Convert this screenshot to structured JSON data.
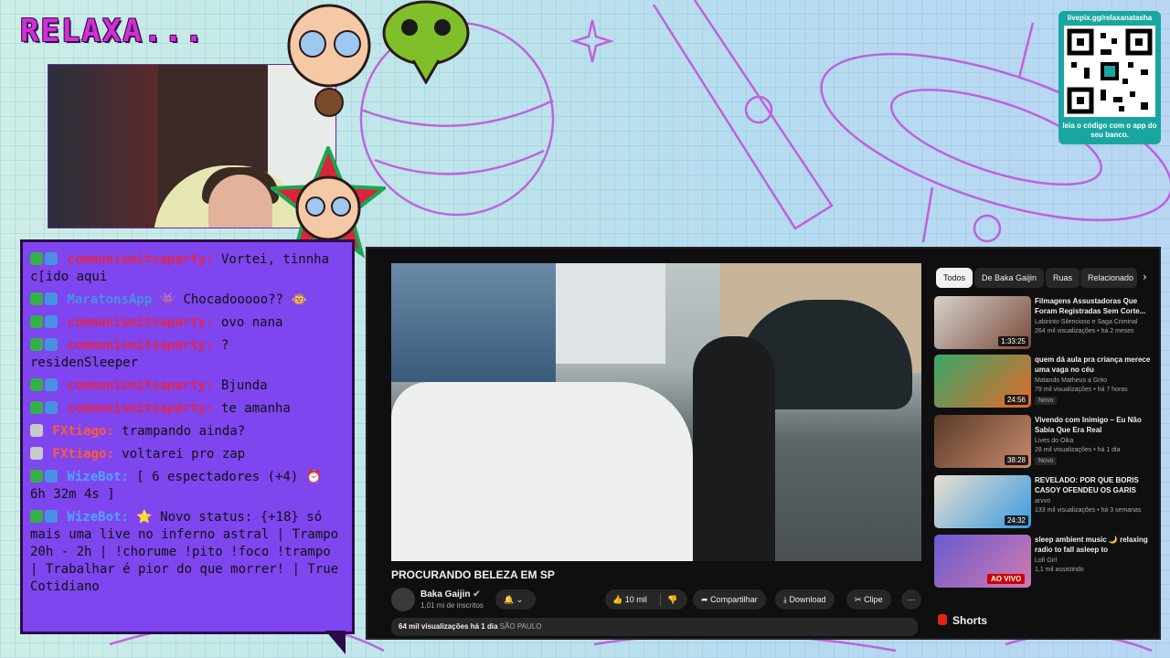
{
  "overlay": {
    "title": "RELAXA...",
    "qr_url": "livepix.gg/relaxanatasha",
    "qr_caption": "leia o código com o app do seu banco."
  },
  "chat": {
    "messages": [
      {
        "badges": [
          "b1",
          "b2"
        ],
        "user": "communismitsaparty:",
        "user_color": "#e0264d",
        "text": " Vortei, tinnha c[ido aqui"
      },
      {
        "badges": [
          "b1",
          "b2"
        ],
        "user": "MaratonsApp",
        "user_color": "#4a90e2",
        "text": " 👾 Chocadooooo?? 🐵"
      },
      {
        "badges": [
          "b1",
          "b2"
        ],
        "user": "communismitsaparty:",
        "user_color": "#e0264d",
        "text": " ovo nana"
      },
      {
        "badges": [
          "b1",
          "b2"
        ],
        "user": "communismitsaparty:",
        "user_color": "#e0264d",
        "text": " ? residenSleeper"
      },
      {
        "badges": [
          "b1",
          "b2"
        ],
        "user": "communismitsaparty:",
        "user_color": "#e0264d",
        "text": " Bjunda"
      },
      {
        "badges": [
          "b1",
          "b2"
        ],
        "user": "communismitsaparty:",
        "user_color": "#e0264d",
        "text": " te amanha"
      },
      {
        "badges": [
          "b3"
        ],
        "user": "FXtiago:",
        "user_color": "#ff5a36",
        "text": " trampando ainda?"
      },
      {
        "badges": [
          "b3"
        ],
        "user": "FXtiago:",
        "user_color": "#ff5a36",
        "text": " voltarei pro zap"
      },
      {
        "badges": [
          "b1",
          "b2"
        ],
        "user": "WizeBot:",
        "user_color": "#4aa8ff",
        "text": " [ 6 espectadores (+4) ⏰ 6h 32m 4s ]"
      },
      {
        "badges": [
          "b1",
          "b2"
        ],
        "user": "WizeBot:",
        "user_color": "#4aa8ff",
        "text": " ⭐ Novo status: {+18} só mais uma live no inferno astral | Trampo 20h - 2h | !chorume !pito !foco !trampo | Trabalhar é pior do que morrer! | True Cotidiano"
      }
    ]
  },
  "youtube": {
    "video_title": "PROCURANDO BELEZA EM SP",
    "channel_name": "Baka Gaijin",
    "channel_subs": "1,01 mi de inscritos",
    "like_count": "10 mil",
    "share_label": "Compartilhar",
    "download_label": "Download",
    "clip_label": "Clipe",
    "more_label": "···",
    "views": "64 mil visualizações",
    "date": "há 1 dia",
    "location": "SÃO PAULO",
    "chips": [
      "Todos",
      "De Baka Gaijin",
      "Ruas",
      "Relacionado"
    ],
    "shorts_label": "Shorts",
    "recommendations": [
      {
        "title": "Filmagens Assustadoras Que Foram Registradas Sem Corte...",
        "channel": "Labirinto Silencioso e Saga Criminal",
        "meta": "264 mil visualizações • há 2 meses",
        "duration": "1:33:25",
        "badge": "",
        "live": "",
        "colors": [
          "#d8d2cc",
          "#7a4a3a"
        ]
      },
      {
        "title": "quem dá aula pra criança merece uma vaga no céu",
        "channel": "Matando Matheus a Grito",
        "meta": "79 mil visualizações • há 7 horas",
        "duration": "24:56",
        "badge": "Novo",
        "live": "",
        "colors": [
          "#3aa86a",
          "#e06a2a"
        ]
      },
      {
        "title": "Vivendo com Inimigo – Eu Não Sabia Que Era Real",
        "channel": "Lives do Oika",
        "meta": "28 mil visualizações • há 1 dia",
        "duration": "38:28",
        "badge": "Novo",
        "live": "",
        "colors": [
          "#5a3a2a",
          "#c88a6a"
        ]
      },
      {
        "title": "REVELADO: POR QUE BORIS CASOY OFENDEU OS GARIS",
        "channel": "arvvo",
        "meta": "133 mil visualizações • há 3 semanas",
        "duration": "24:32",
        "badge": "",
        "live": "",
        "colors": [
          "#e8e0d0",
          "#3a9ae0"
        ]
      },
      {
        "title": "sleep ambient music 🌙 relaxing radio to fall asleep to",
        "channel": "Lofi Girl",
        "meta": "1,1 mil assistindo",
        "duration": "",
        "badge": "",
        "live": "AO VIVO",
        "colors": [
          "#6a5ad0",
          "#d07ab0"
        ]
      }
    ]
  }
}
